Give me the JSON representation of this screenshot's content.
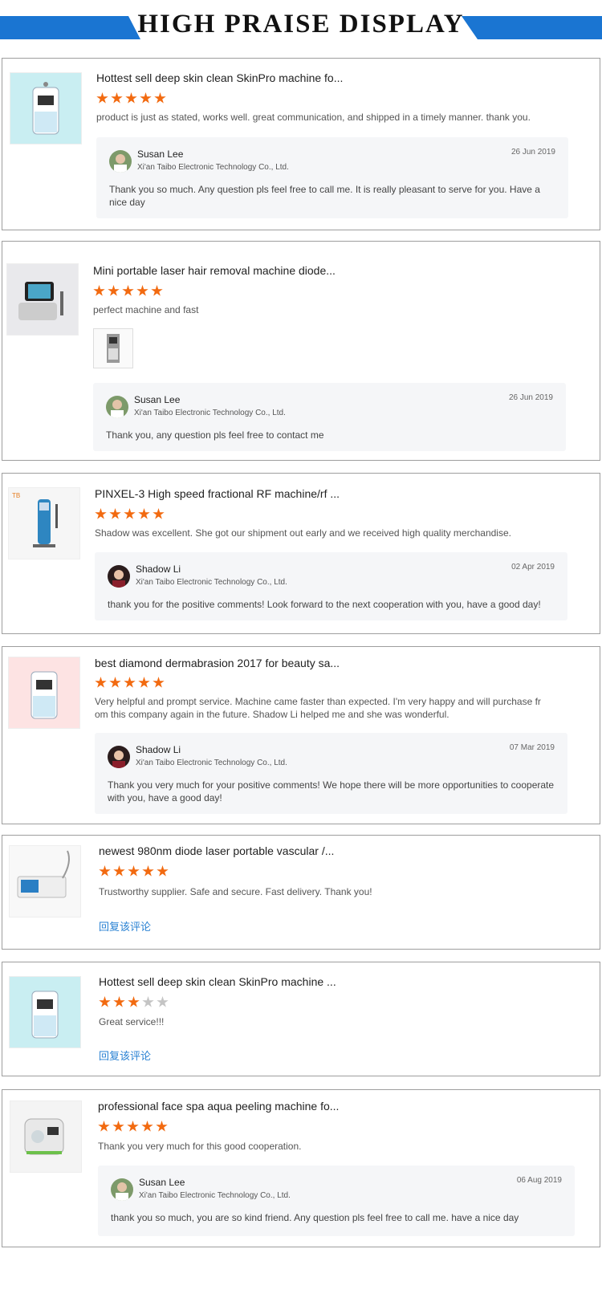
{
  "banner": {
    "title": "HIGH PRAISE DISPLAY",
    "accent": "#1a75d2"
  },
  "colors": {
    "star": "#f26a10",
    "star_off": "#c4c4c4",
    "link": "#2a82d3",
    "reply_bg": "#f5f6f8"
  },
  "reviews": [
    {
      "product_title": "Hottest sell deep skin clean SkinPro machine fo...",
      "rating": 5,
      "text": "product is just as stated, works well. great communication, and shipped in a timely manner. thank you.",
      "reply": {
        "name": "Susan Lee",
        "company": "Xi'an Taibo Electronic Technology Co., Ltd.",
        "date": "26 Jun 2019",
        "text": "Thank you so much. Any question pls feel free to call me. It is really pleasant to serve for you. Have a nice day"
      }
    },
    {
      "product_title": "Mini portable laser hair removal machine diode...",
      "rating": 5,
      "text": "perfect machine and fast",
      "reply": {
        "name": "Susan Lee",
        "company": "Xi'an Taibo Electronic Technology Co., Ltd.",
        "date": "26 Jun 2019",
        "text": "Thank you, any question pls feel free to contact me"
      }
    },
    {
      "product_title": "PINXEL-3 High speed fractional RF machine/rf ...",
      "rating": 5,
      "text": "Shadow was excellent.  She got our shipment out early and we received high quality merchandise.",
      "reply": {
        "name": "Shadow Li",
        "company": "Xi'an Taibo Electronic Technology Co., Ltd.",
        "date": "02 Apr 2019",
        "text": "thank you for the positive comments!  Look forward to the next cooperation with you, have a good day!"
      }
    },
    {
      "product_title": "best diamond dermabrasion 2017 for beauty sa...",
      "rating": 5,
      "text": "Very helpful and prompt service. Machine came faster than expected. I'm very happy and will purchase fr om this company again in the future. Shadow Li helped me and she was wonderful.",
      "reply": {
        "name": "Shadow Li",
        "company": "Xi'an Taibo Electronic Technology Co., Ltd.",
        "date": "07 Mar 2019",
        "text": "Thank you very much for your positive comments! We hope there will be more opportunities to cooperate with you, have a good day!"
      }
    },
    {
      "product_title": "newest 980nm diode laser portable vascular /...",
      "rating": 5,
      "text": "Trustworthy supplier. Safe and secure. Fast delivery. Thank you!",
      "reply_link": "回复该评论"
    },
    {
      "product_title": "Hottest sell deep skin clean SkinPro machine ...",
      "rating": 3,
      "text": "Great service!!!",
      "reply_link": "回复该评论"
    },
    {
      "product_title": "professional face spa aqua peeling machine fo...",
      "rating": 5,
      "text": "Thank you very much for this good cooperation.",
      "reply": {
        "name": "Susan Lee",
        "company": "Xi'an Taibo Electronic Technology Co., Ltd.",
        "date": "06 Aug 2019",
        "text": "thank you so much, you are so kind friend. Any question pls feel free to call me. have a nice day"
      }
    }
  ]
}
